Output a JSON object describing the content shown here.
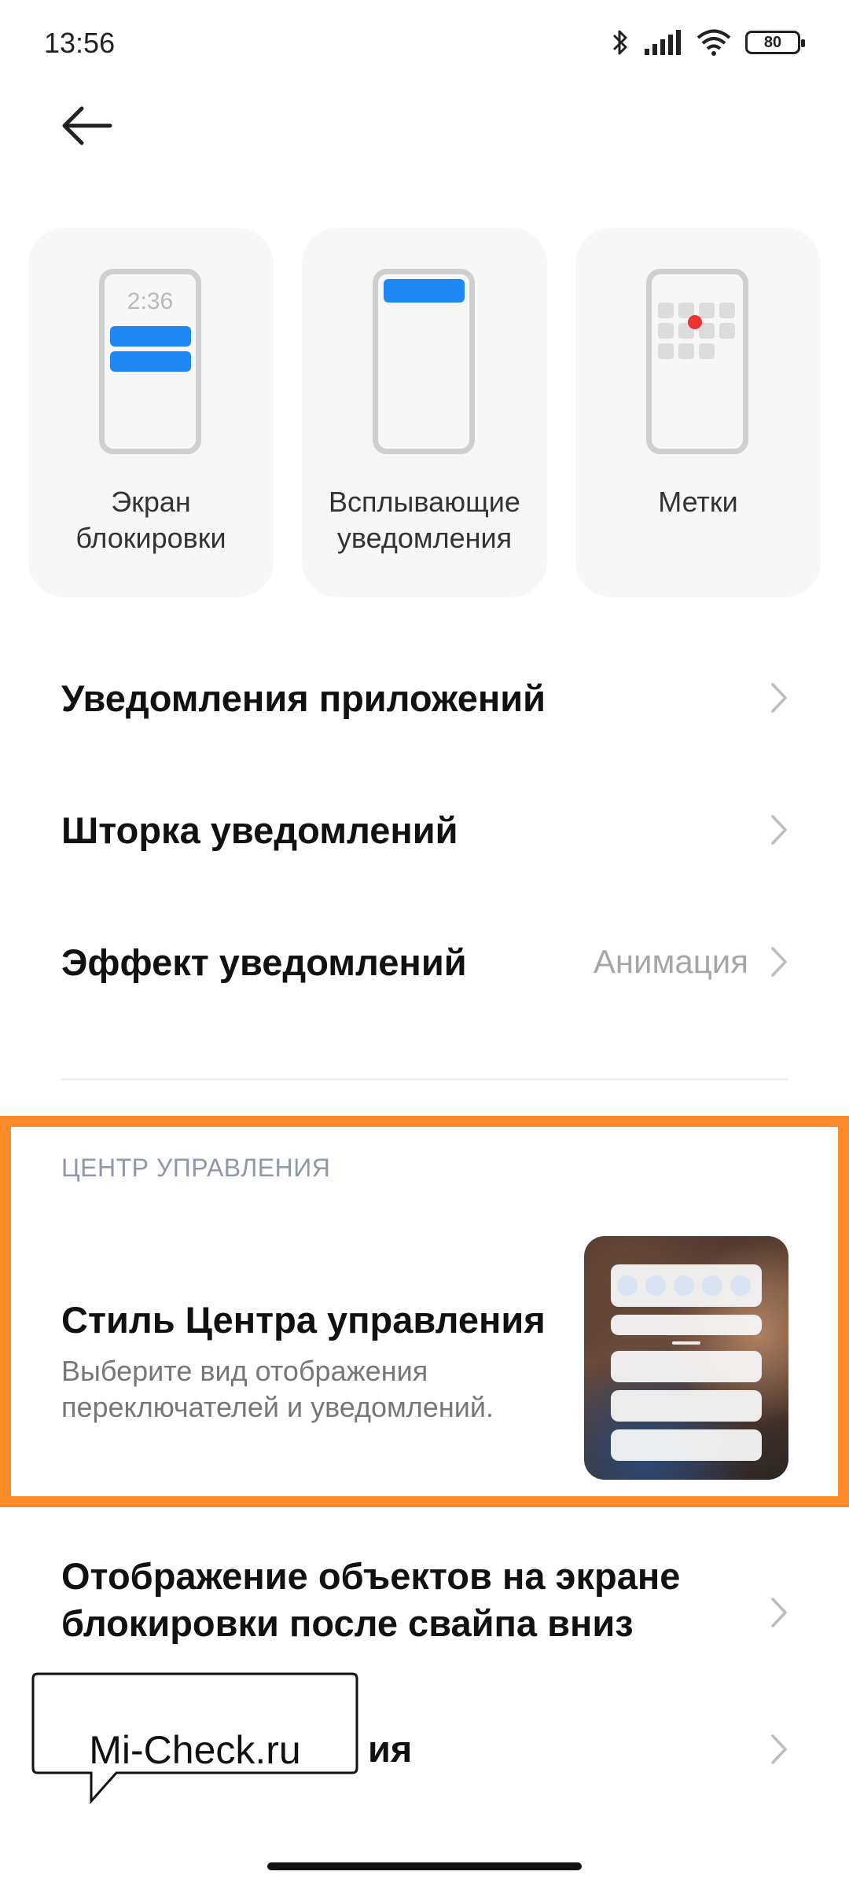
{
  "status_bar": {
    "time": "13:56",
    "battery": "80",
    "icons": [
      "bluetooth-icon",
      "signal-icon",
      "wifi-icon",
      "battery-icon"
    ]
  },
  "nav": {
    "back_icon": "arrow-left-icon"
  },
  "style_cards": [
    {
      "line1": "Экран",
      "line2": "блокировки",
      "preview_time": "2:36"
    },
    {
      "line1": "Всплывающие",
      "line2": "уведомления"
    },
    {
      "line1": "Метки",
      "line2": ""
    }
  ],
  "list": {
    "app_notifications": "Уведомления приложений",
    "notification_shade": "Шторка уведомлений",
    "notification_effect": "Эффект уведомлений",
    "notification_effect_value": "Анимация"
  },
  "control_center": {
    "section_title": "ЦЕНТР УПРАВЛЕНИЯ",
    "style_title": "Стиль Центра управления",
    "style_desc_line1": "Выберите вид отображения",
    "style_desc_line2": "переключателей и уведомлений."
  },
  "footer": {
    "lockscreen_line1": "Отображение объектов на экране",
    "lockscreen_line2": "блокировки после свайпа вниз",
    "partial_item": "ия"
  },
  "watermark": "Mi-Check.ru",
  "colors": {
    "accent_blue": "#1e88f5",
    "highlight_orange": "#ff8a2a",
    "badge_red": "#ee3333",
    "section_header": "#8f97a8"
  }
}
